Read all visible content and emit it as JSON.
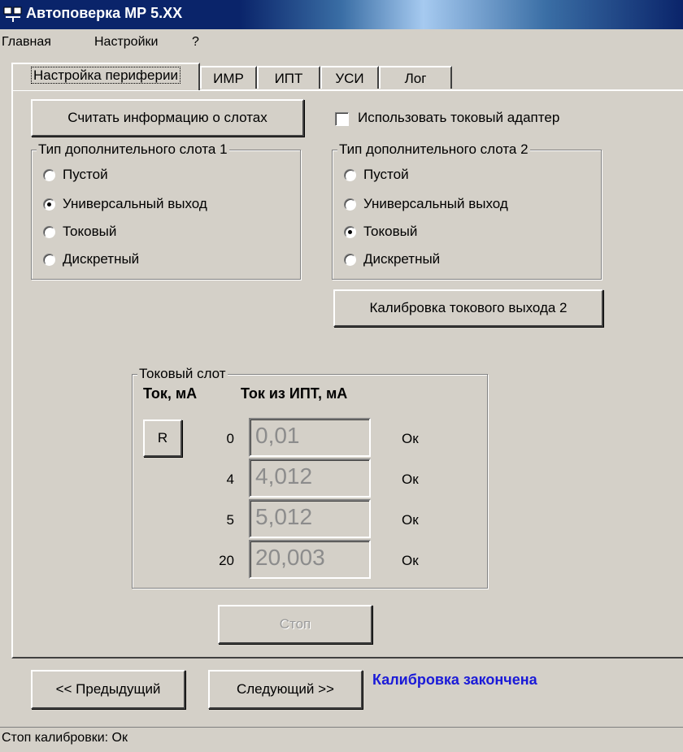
{
  "window": {
    "title": "Автоповерка МР 5.XX"
  },
  "menu": [
    "Главная",
    "Настройки",
    "?"
  ],
  "tabs": [
    "Настройка периферии",
    "ИМР",
    "ИПТ",
    "УСИ",
    "Лог"
  ],
  "main": {
    "read_slots_button": "Считать информацию о слотах",
    "use_current_adapter": {
      "label": "Использовать токовый адаптер",
      "checked": false
    },
    "slot1": {
      "title": "Тип дополнительного слота 1",
      "options": [
        "Пустой",
        "Универсальный выход",
        "Токовый",
        "Дискретный"
      ],
      "selected": "Универсальный выход"
    },
    "slot2": {
      "title": "Тип дополнительного слота 2",
      "options": [
        "Пустой",
        "Универсальный выход",
        "Токовый",
        "Дискретный"
      ],
      "selected": "Токовый"
    },
    "calibrate_button": "Калибровка токового выхода 2",
    "current_slot": {
      "title": "Токовый слот",
      "col1": "Ток, мА",
      "col2": "Ток из ИПТ, мА",
      "reset_button": "R",
      "rows": [
        {
          "set": "0",
          "value": "0,01",
          "status": "Ок"
        },
        {
          "set": "4",
          "value": "4,012",
          "status": "Ок"
        },
        {
          "set": "5",
          "value": "5,012",
          "status": "Ок"
        },
        {
          "set": "20",
          "value": "20,003",
          "status": "Ок"
        }
      ]
    },
    "stop_button": "Стоп"
  },
  "footer": {
    "prev_button": "<< Предыдущий",
    "next_button": "Следующий >>",
    "message": "Калибровка закончена",
    "message_color": "#1a1ad8"
  },
  "status_bar": {
    "text": "Стоп калибровки: Ок"
  },
  "colors": {
    "titlebar": "#0a246a",
    "face": "#d4d0c8"
  }
}
